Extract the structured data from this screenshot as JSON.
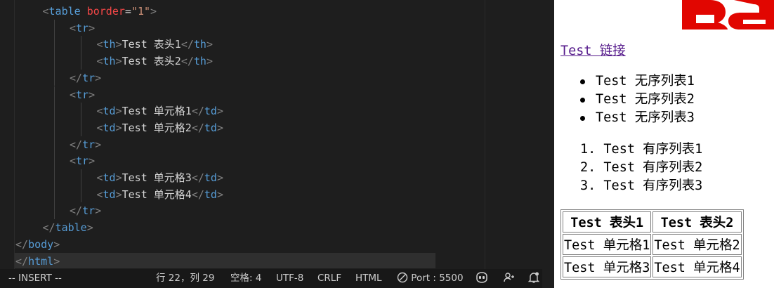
{
  "editor": {
    "lines": [
      {
        "indent": 1,
        "parts": [
          [
            "b",
            "<"
          ],
          [
            "t",
            "table"
          ],
          [
            "s",
            " "
          ],
          [
            "a",
            "border"
          ],
          [
            "s",
            "="
          ],
          [
            "v",
            "\"1\""
          ],
          [
            "b",
            ">"
          ]
        ]
      },
      {
        "indent": 2,
        "parts": [
          [
            "b",
            "<"
          ],
          [
            "t",
            "tr"
          ],
          [
            "b",
            ">"
          ]
        ]
      },
      {
        "indent": 3,
        "parts": [
          [
            "b",
            "<"
          ],
          [
            "t",
            "th"
          ],
          [
            "b",
            ">"
          ],
          [
            "x",
            "Test 表头1"
          ],
          [
            "b",
            "</"
          ],
          [
            "t",
            "th"
          ],
          [
            "b",
            ">"
          ]
        ]
      },
      {
        "indent": 3,
        "parts": [
          [
            "b",
            "<"
          ],
          [
            "t",
            "th"
          ],
          [
            "b",
            ">"
          ],
          [
            "x",
            "Test 表头2"
          ],
          [
            "b",
            "</"
          ],
          [
            "t",
            "th"
          ],
          [
            "b",
            ">"
          ]
        ]
      },
      {
        "indent": 2,
        "parts": [
          [
            "b",
            "</"
          ],
          [
            "t",
            "tr"
          ],
          [
            "b",
            ">"
          ]
        ]
      },
      {
        "indent": 2,
        "parts": [
          [
            "b",
            "<"
          ],
          [
            "t",
            "tr"
          ],
          [
            "b",
            ">"
          ]
        ]
      },
      {
        "indent": 3,
        "parts": [
          [
            "b",
            "<"
          ],
          [
            "t",
            "td"
          ],
          [
            "b",
            ">"
          ],
          [
            "x",
            "Test 单元格1"
          ],
          [
            "b",
            "</"
          ],
          [
            "t",
            "td"
          ],
          [
            "b",
            ">"
          ]
        ]
      },
      {
        "indent": 3,
        "parts": [
          [
            "b",
            "<"
          ],
          [
            "t",
            "td"
          ],
          [
            "b",
            ">"
          ],
          [
            "x",
            "Test 单元格2"
          ],
          [
            "b",
            "</"
          ],
          [
            "t",
            "td"
          ],
          [
            "b",
            ">"
          ]
        ]
      },
      {
        "indent": 2,
        "parts": [
          [
            "b",
            "</"
          ],
          [
            "t",
            "tr"
          ],
          [
            "b",
            ">"
          ]
        ]
      },
      {
        "indent": 2,
        "parts": [
          [
            "b",
            "<"
          ],
          [
            "t",
            "tr"
          ],
          [
            "b",
            ">"
          ]
        ]
      },
      {
        "indent": 3,
        "parts": [
          [
            "b",
            "<"
          ],
          [
            "t",
            "td"
          ],
          [
            "b",
            ">"
          ],
          [
            "x",
            "Test 单元格3"
          ],
          [
            "b",
            "</"
          ],
          [
            "t",
            "td"
          ],
          [
            "b",
            ">"
          ]
        ]
      },
      {
        "indent": 3,
        "parts": [
          [
            "b",
            "<"
          ],
          [
            "t",
            "td"
          ],
          [
            "b",
            ">"
          ],
          [
            "x",
            "Test 单元格4"
          ],
          [
            "b",
            "</"
          ],
          [
            "t",
            "td"
          ],
          [
            "b",
            ">"
          ]
        ]
      },
      {
        "indent": 2,
        "parts": [
          [
            "b",
            "</"
          ],
          [
            "t",
            "tr"
          ],
          [
            "b",
            ">"
          ]
        ]
      },
      {
        "indent": 1,
        "parts": [
          [
            "b",
            "</"
          ],
          [
            "t",
            "table"
          ],
          [
            "b",
            ">"
          ]
        ]
      },
      {
        "indent": 0,
        "parts": [
          [
            "b",
            "</"
          ],
          [
            "t",
            "body"
          ],
          [
            "b",
            ">"
          ]
        ]
      },
      {
        "indent": 0,
        "parts": [
          [
            "b",
            "</"
          ],
          [
            "t",
            "html"
          ],
          [
            "b",
            ">"
          ]
        ]
      }
    ]
  },
  "statusbar": {
    "mode": "-- INSERT --",
    "position": "行 22，列 29",
    "spaces": "空格: 4",
    "encoding": "UTF-8",
    "eol": "CRLF",
    "language": "HTML",
    "port": "Port : 5500",
    "copilot_icon": "copilot-icon",
    "feedback_icon": "feedback-icon",
    "bell_icon": "bell-icon"
  },
  "preview": {
    "link_text": "Test 链接",
    "unordered": [
      "Test 无序列表1",
      "Test 无序列表2",
      "Test 无序列表3"
    ],
    "ordered": [
      "1. Test 有序列表1",
      "2. Test 有序列表2",
      "3. Test 有序列表3"
    ],
    "table": {
      "headers": [
        "Test 表头1",
        "Test 表头2"
      ],
      "rows": [
        [
          "Test 单元格1",
          "Test 单元格2"
        ],
        [
          "Test 单元格3",
          "Test 单元格4"
        ]
      ]
    },
    "logo_color": "#e10601"
  }
}
